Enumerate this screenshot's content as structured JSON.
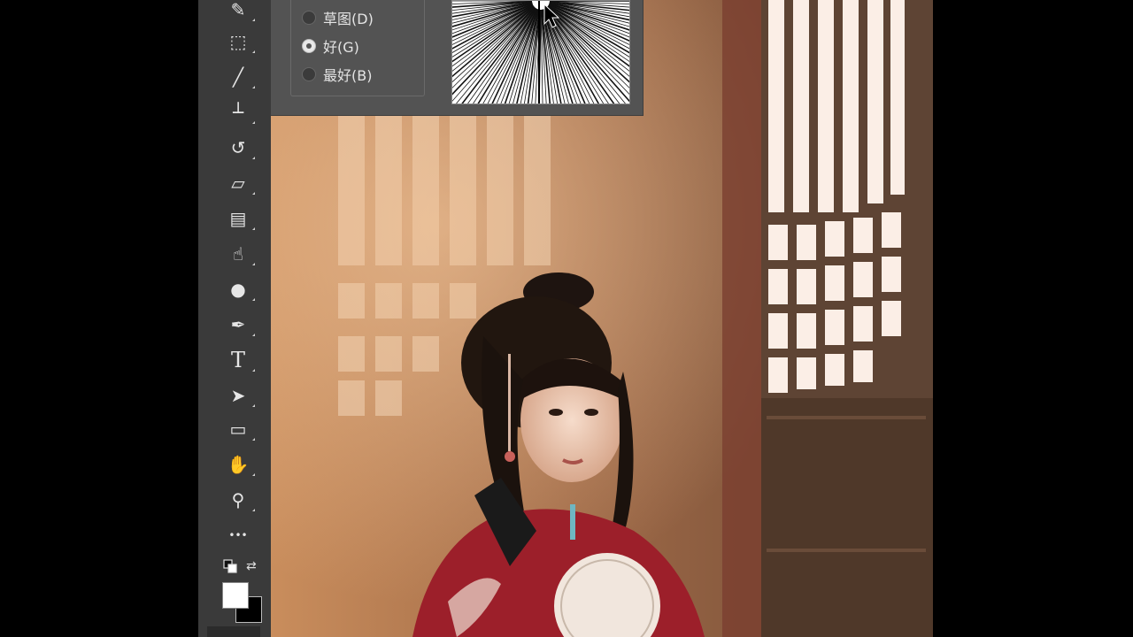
{
  "dialog": {
    "quality_options": [
      {
        "label": "草图(D)",
        "selected": false
      },
      {
        "label": "好(G)",
        "selected": true
      },
      {
        "label": "最好(B)",
        "selected": false
      }
    ]
  },
  "toolbar": {
    "tools": [
      {
        "name": "eyedropper-tool",
        "icon": "eyedropper-icon",
        "glyph": "✎"
      },
      {
        "name": "patch-tool",
        "icon": "patch-icon",
        "glyph": "⬚"
      },
      {
        "name": "brush-tool",
        "icon": "brush-icon",
        "glyph": "╱"
      },
      {
        "name": "clone-stamp-tool",
        "icon": "stamp-icon",
        "glyph": "┴"
      },
      {
        "name": "history-brush-tool",
        "icon": "history-brush-icon",
        "glyph": "↺"
      },
      {
        "name": "eraser-tool",
        "icon": "eraser-icon",
        "glyph": "▱"
      },
      {
        "name": "gradient-tool",
        "icon": "gradient-icon",
        "glyph": "▤"
      },
      {
        "name": "smudge-tool",
        "icon": "smudge-icon",
        "glyph": "☝"
      },
      {
        "name": "dodge-tool",
        "icon": "dodge-icon",
        "glyph": "●"
      },
      {
        "name": "pen-tool",
        "icon": "pen-icon",
        "glyph": "✒"
      },
      {
        "name": "type-tool",
        "icon": "type-icon",
        "glyph": "T"
      },
      {
        "name": "path-selection-tool",
        "icon": "arrow-icon",
        "glyph": "➤"
      },
      {
        "name": "rectangle-tool",
        "icon": "rectangle-icon",
        "glyph": "▭"
      },
      {
        "name": "hand-tool",
        "icon": "hand-icon",
        "glyph": "✋"
      },
      {
        "name": "zoom-tool",
        "icon": "zoom-icon",
        "glyph": "⚲"
      },
      {
        "name": "more-tools",
        "icon": "ellipsis-icon",
        "glyph": "•••"
      }
    ],
    "foreground_color": "#ffffff",
    "background_color": "#000000"
  }
}
